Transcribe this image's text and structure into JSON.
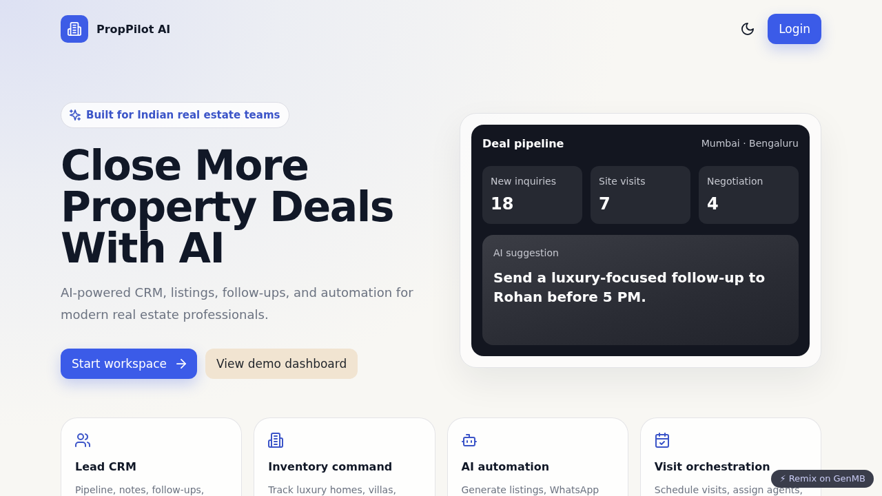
{
  "header": {
    "brand": "PropPilot AI",
    "login_button": "Login"
  },
  "hero": {
    "tag": "Built for Indian real estate teams",
    "headline": "Close More Property Deals With AI",
    "description": "AI-powered CRM, listings, follow-ups, and automation for modern real estate professionals.",
    "buttons": [
      {
        "label": "Start workspace",
        "kind": "primary"
      },
      {
        "label": "View demo dashboard",
        "kind": "secondary"
      }
    ]
  },
  "pipeline": {
    "title": "Deal pipeline",
    "cities": "Mumbai · Bengaluru",
    "stats": [
      {
        "label": "New inquiries",
        "value": "18"
      },
      {
        "label": "Site visits",
        "value": "7"
      },
      {
        "label": "Negotiation",
        "value": "4"
      }
    ],
    "suggestion": {
      "label": "AI suggestion",
      "text": "Send a luxury-focused follow-up to Rohan before 5 PM."
    }
  },
  "features": [
    {
      "kind": "leads",
      "title": "Lead CRM",
      "description": "Pipeline, notes, follow-ups,"
    },
    {
      "kind": "inventory",
      "title": "Inventory command",
      "description": "Track luxury homes, villas,"
    },
    {
      "kind": "automation",
      "title": "AI automation",
      "description": "Generate listings, WhatsApp"
    },
    {
      "kind": "visits",
      "title": "Visit orchestration",
      "description": "Schedule visits, assign agents,"
    }
  ],
  "remix_link": "⚡ Remix on GenMB"
}
